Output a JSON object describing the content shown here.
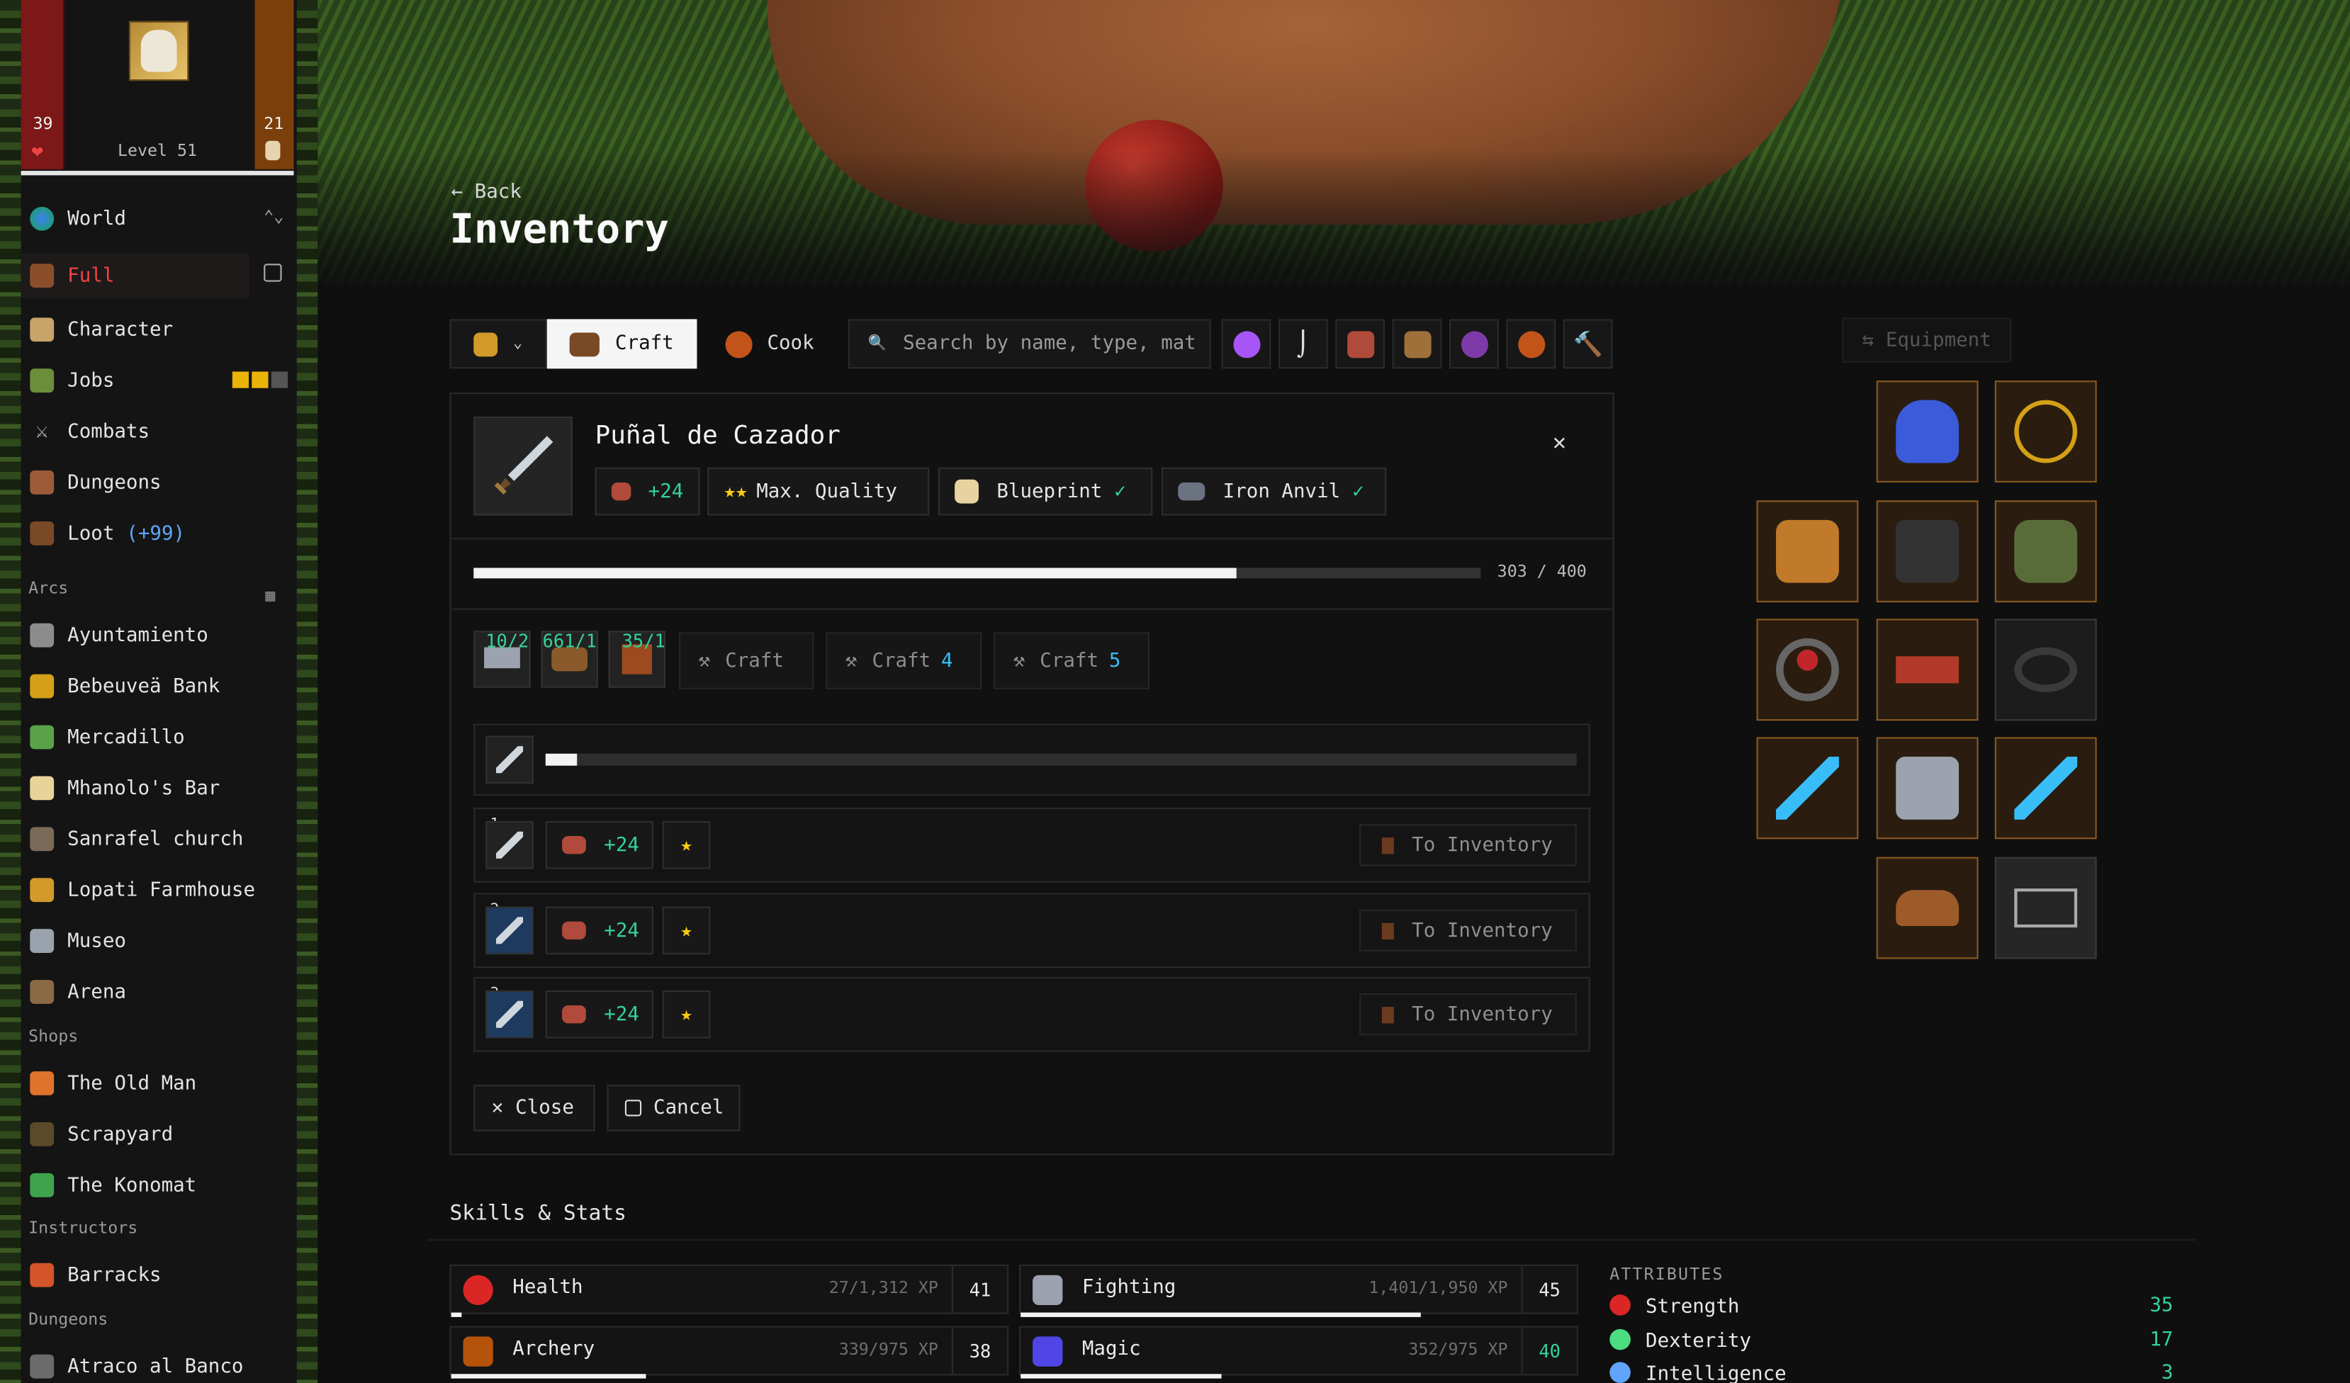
{
  "hud": {
    "hp": "39",
    "xp": "21",
    "level": "Level 51"
  },
  "nav": {
    "world": "World",
    "full": "Full",
    "character": "Character",
    "jobs": "Jobs",
    "combats": "Combats",
    "dungeons": "Dungeons",
    "loot": "Loot",
    "loot_badge": "(+99)",
    "arcs_label": "Arcs",
    "arcs": [
      "Ayuntamiento",
      "Bebeuveä Bank",
      "Mercadillo",
      "Mhanolo's Bar",
      "Sanrafel church",
      "Lopati Farmhouse",
      "Museo",
      "Arena"
    ],
    "shops_label": "Shops",
    "shops": [
      "The Old Man",
      "Scrapyard",
      "The Konomat"
    ],
    "instructors_label": "Instructors",
    "instructors": [
      "Barracks"
    ],
    "dungeons_label": "Dungeons",
    "dungeon_list": [
      "Atraco al Banco"
    ]
  },
  "header": {
    "back": "← Back",
    "title": "Inventory"
  },
  "toolbar": {
    "craft": "Craft",
    "cook": "Cook",
    "search_placeholder": "Search by name, type, mat",
    "filter_icons": [
      "orb-icon",
      "hook-icon",
      "anvil-icon",
      "chest-icon",
      "grapes-icon",
      "pot-icon",
      "hammer-icon"
    ]
  },
  "craft": {
    "item_name": "Puñal de Cazador",
    "bonus": "+24",
    "quality": "Max. Quality",
    "blueprint": "Blueprint",
    "station": "Iron Anvil",
    "progress_text": "303 / 400",
    "progress_fraction": 0.7575,
    "materials": [
      {
        "count": "10/2",
        "icon": "iron-bar-icon"
      },
      {
        "count": "661/1",
        "icon": "wood-logs-icon"
      },
      {
        "count": "35/1",
        "icon": "leather-icon"
      }
    ],
    "craft_label": "Craft",
    "craft_4_label": "Craft",
    "craft_4_count": "4",
    "craft_5_label": "Craft",
    "craft_5_count": "5",
    "queue_fraction": 0.03,
    "results": [
      {
        "index": "1",
        "bonus": "+24",
        "stars": "★"
      },
      {
        "index": "2",
        "bonus": "+24",
        "stars": "★"
      },
      {
        "index": "3",
        "bonus": "+24",
        "stars": "★"
      }
    ],
    "to_inventory": "To Inventory",
    "close": "Close",
    "cancel": "Cancel"
  },
  "equipment": {
    "header": "Equipment"
  },
  "skills": {
    "title": "Skills & Stats",
    "list": [
      {
        "name": "Health",
        "xp": "27/1,312 XP",
        "level": "41",
        "fraction": 0.02
      },
      {
        "name": "Fighting",
        "xp": "1,401/1,950 XP",
        "level": "45",
        "fraction": 0.72
      },
      {
        "name": "Archery",
        "xp": "339/975 XP",
        "level": "38",
        "fraction": 0.35
      },
      {
        "name": "Magic",
        "xp": "352/975 XP",
        "level": "40",
        "fraction": 0.36
      }
    ],
    "attributes_label": "ATTRIBUTES",
    "attributes": [
      {
        "name": "Strength",
        "value": "35",
        "color": "#dc2626"
      },
      {
        "name": "Dexterity",
        "value": "17",
        "color": "#4ade80"
      },
      {
        "name": "Intelligence",
        "value": "3",
        "color": "#60a5fa"
      }
    ]
  },
  "colors": {
    "accent_red": "#ef4444",
    "green": "#34d399",
    "blue": "#38bdf8",
    "hp": "#7c1818",
    "xp": "#7a3f0a"
  }
}
